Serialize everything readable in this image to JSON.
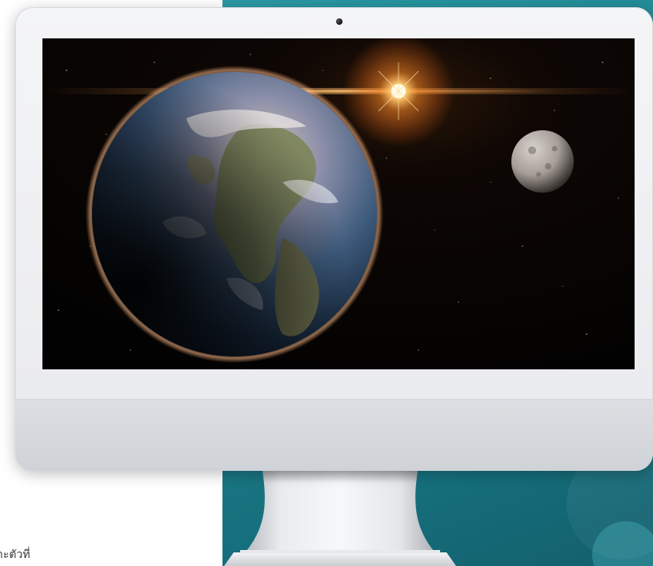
{
  "caption": {
    "text": "าะตัวที่"
  },
  "colors": {
    "teal_panel": "#1d7f8c",
    "bezel": "#f4f5f7",
    "chin": "#d6d8dc",
    "screen_bg": "#000000"
  },
  "icons": {
    "camera": "camera-icon"
  }
}
